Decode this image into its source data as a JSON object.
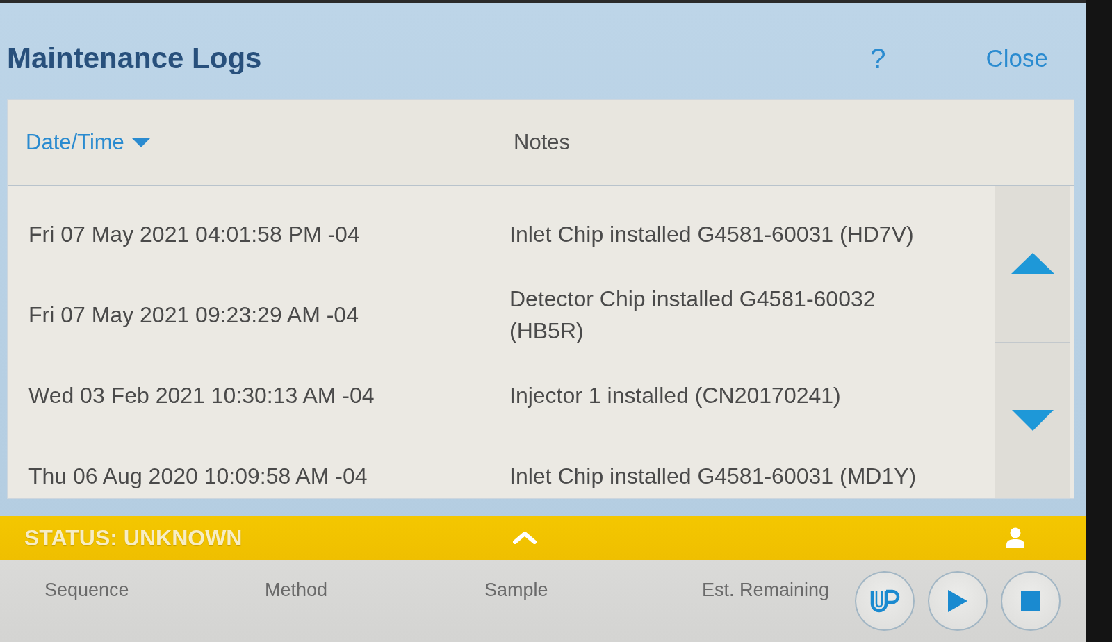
{
  "window": {
    "title": "Maintenance Logs",
    "help": "?",
    "close": "Close"
  },
  "table": {
    "columns": [
      {
        "label": "Date/Time",
        "sorted": true,
        "descending": true
      },
      {
        "label": "Notes",
        "sorted": false
      }
    ],
    "rows": [
      {
        "date_time": "Fri 07 May 2021 04:01:58 PM -04",
        "notes": "Inlet Chip installed G4581-60031 (HD7V)"
      },
      {
        "date_time": "Fri 07 May 2021 09:23:29 AM -04",
        "notes": "Detector Chip installed G4581-60032 (HB5R)"
      },
      {
        "date_time": "Wed 03 Feb 2021 10:30:13 AM -04",
        "notes": "Injector 1 installed (CN20170241)"
      },
      {
        "date_time": "Thu 06 Aug 2020 10:09:58 AM -04",
        "notes": "Inlet Chip installed G4581-60031 (MD1Y)"
      }
    ]
  },
  "status_bar": {
    "status": "STATUS: UNKNOWN"
  },
  "run_bar": {
    "labels": [
      "Sequence",
      "Method",
      "Sample",
      "Est. Remaining"
    ]
  }
}
